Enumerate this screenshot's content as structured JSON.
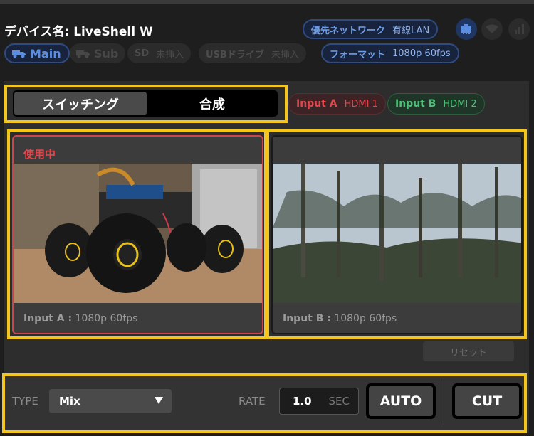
{
  "header": {
    "device_label": "デバイス名:",
    "device_name": "LiveShell W",
    "network_label": "優先ネットワーク",
    "network_value": "有線LAN",
    "main": "Main",
    "sub": "Sub",
    "sd_label": "SD",
    "sd_value": "未挿入",
    "usb_label": "USBドライブ",
    "usb_value": "未挿入",
    "format_label": "フォーマット",
    "format_value": "1080p 60fps"
  },
  "mode": {
    "switching": "スイッチング",
    "compose": "合成"
  },
  "inputs": {
    "a": {
      "name": "Input A",
      "source": "HDMI 1"
    },
    "b": {
      "name": "Input B",
      "source": "HDMI 2"
    }
  },
  "tiles": {
    "a": {
      "badge": "使用中",
      "label": "Input A :",
      "format": "1080p 60fps"
    },
    "b": {
      "label": "Input B :",
      "format": "1080p 60fps"
    }
  },
  "reset": "リセット",
  "controls": {
    "type_label": "TYPE",
    "type_value": "Mix",
    "rate_label": "RATE",
    "rate_value": "1.0",
    "rate_unit": "SEC",
    "auto": "AUTO",
    "cut": "CUT"
  },
  "colors": {
    "highlight": "#f5c518",
    "input_a": "#e0474c",
    "input_b": "#4fbf78",
    "accent": "#6e9ee8"
  }
}
